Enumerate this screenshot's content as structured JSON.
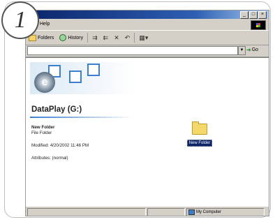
{
  "step_marker": "1",
  "menu": {
    "help_label": "Help"
  },
  "window_controls": {
    "minimize": "_",
    "maximize": "□",
    "close": "×"
  },
  "toolbar": {
    "folders_label": "Folders",
    "history_label": "History"
  },
  "address": {
    "value": "",
    "go_label": "Go"
  },
  "drive": {
    "title": "DataPlay (G:)"
  },
  "selected_item": {
    "name": "New Folder",
    "type": "File Folder",
    "modified": "Modified: 4/20/2002 11:46 PM",
    "attributes": "Attributes: (normal)"
  },
  "folder_item": {
    "label": "New Folder"
  },
  "status": {
    "zone_label": "My Computer"
  },
  "colors": {
    "titlebar": "#0a246a",
    "chrome": "#d4d0c8",
    "selection": "#0a246a",
    "folder": "#f5d86a"
  }
}
